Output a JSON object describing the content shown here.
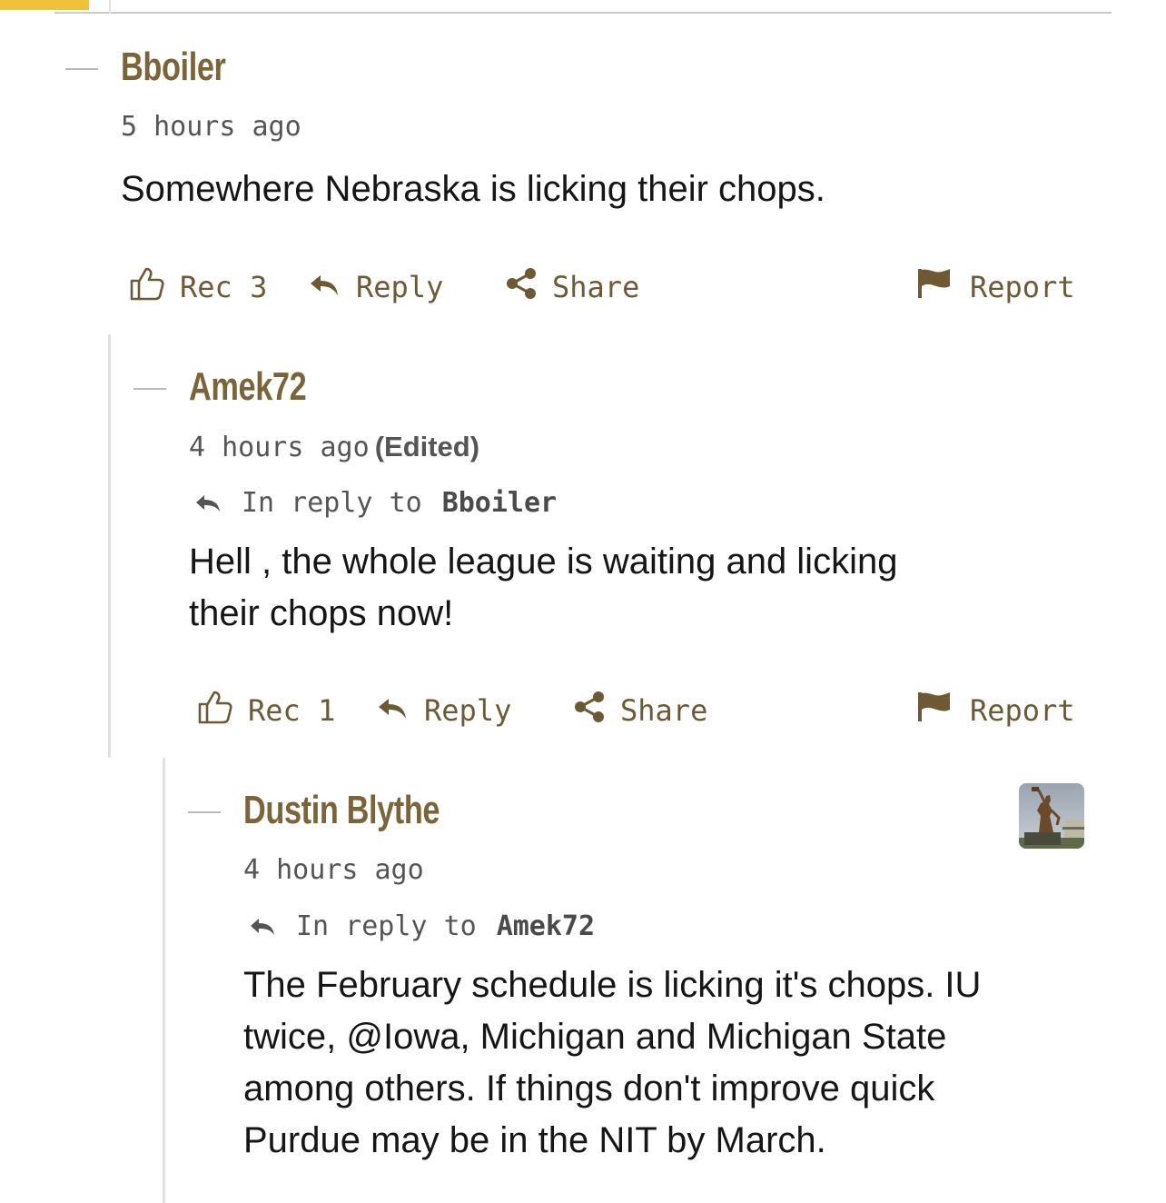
{
  "theme": {
    "accent": "#f0c13a",
    "author_color": "#7b6437",
    "action_color": "#6d5a35"
  },
  "comments": [
    {
      "author": "Bboiler",
      "time": "5 hours ago",
      "edited": "",
      "reply_to_prefix": "",
      "reply_to": "",
      "body": [
        "Somewhere Nebraska is licking their chops."
      ],
      "actions": {
        "rec": "Rec 3",
        "reply": "Reply",
        "share": "Share",
        "report": "Report"
      }
    },
    {
      "author": "Amek72",
      "time": "4 hours ago",
      "edited": "(Edited)",
      "reply_to_prefix": "In reply to",
      "reply_to": "Bboiler",
      "body": [
        "Hell , the whole league is waiting and licking",
        "their chops now!"
      ],
      "actions": {
        "rec": "Rec 1",
        "reply": "Reply",
        "share": "Share",
        "report": "Report"
      }
    },
    {
      "author": "Dustin Blythe",
      "time": "4 hours ago",
      "edited": "",
      "reply_to_prefix": "In reply to",
      "reply_to": "Amek72",
      "body": [
        "The February schedule is licking it's chops. IU",
        "twice, @Iowa, Michigan and Michigan State",
        "among others. If things don't improve quick",
        "Purdue may be in the NIT by March."
      ],
      "avatar_icon": "statue-avatar-icon"
    }
  ]
}
